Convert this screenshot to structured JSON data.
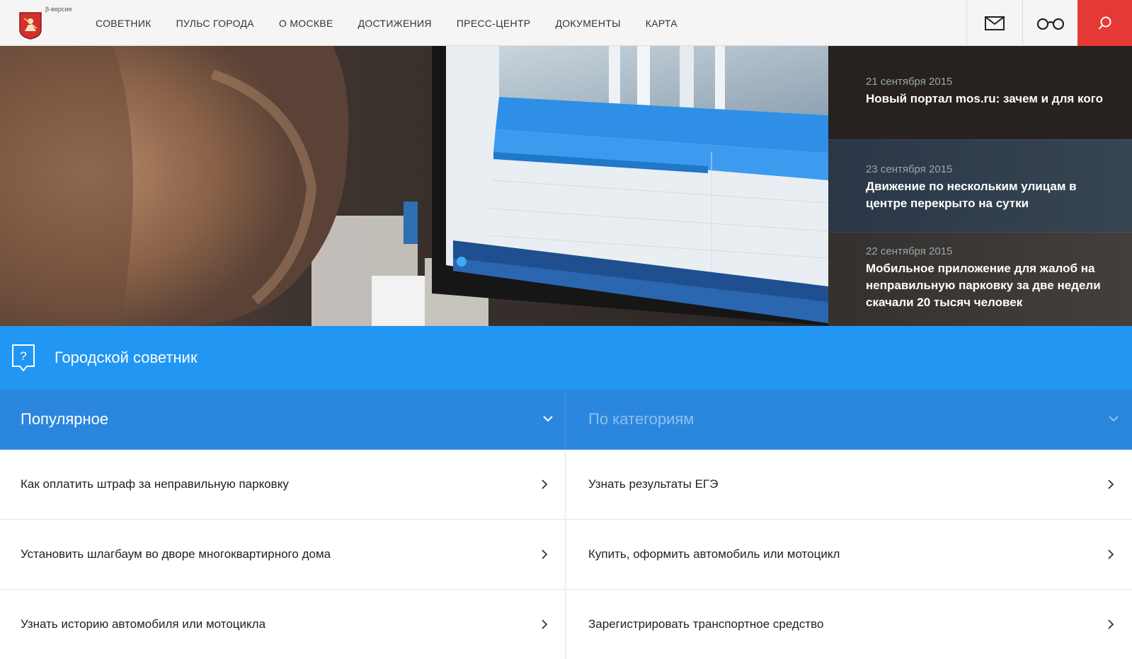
{
  "header": {
    "beta_label": "β-версия",
    "nav": [
      {
        "label": "СОВЕТНИК"
      },
      {
        "label": "ПУЛЬС ГОРОДА"
      },
      {
        "label": "О МОСКВЕ"
      },
      {
        "label": "ДОСТИЖЕНИЯ"
      },
      {
        "label": "ПРЕСС-ЦЕНТР"
      },
      {
        "label": "ДОКУМЕНТЫ"
      },
      {
        "label": "КАРТА"
      }
    ],
    "icons": {
      "mail": "mail-icon",
      "accessibility": "glasses-icon",
      "search": "search-icon"
    },
    "colors": {
      "search_bg": "#e53935"
    }
  },
  "news": [
    {
      "date": "21 сентября 2015",
      "title": "Новый портал mos.ru: зачем и для кого"
    },
    {
      "date": "23 сентября 2015",
      "title": "Движение по нескольким улицам в центре перекрыто на сутки"
    },
    {
      "date": "22 сентября 2015",
      "title": "Мобильное приложение для жалоб на неправильную парковку за две недели скачали 20 тысяч человек"
    }
  ],
  "hero_photo": {
    "screen_title": "Городской советник",
    "screen_tab_popular": "Популярное",
    "screen_tab_categories": "По категориям"
  },
  "advisor": {
    "title": "Городской советник",
    "icon": "question-badge-icon",
    "color": "#2196f3"
  },
  "tabs": {
    "popular": "Популярное",
    "categories": "По категориям"
  },
  "popular_items": [
    {
      "label": "Как оплатить штраф за неправильную парковку"
    },
    {
      "label": "Установить шлагбаум во дворе многоквартирного дома"
    },
    {
      "label": "Узнать историю автомобиля или мотоцикла"
    }
  ],
  "category_items": [
    {
      "label": "Узнать результаты ЕГЭ"
    },
    {
      "label": "Купить, оформить автомобиль или мотоцикл"
    },
    {
      "label": "Зарегистрировать транспортное средство"
    }
  ]
}
